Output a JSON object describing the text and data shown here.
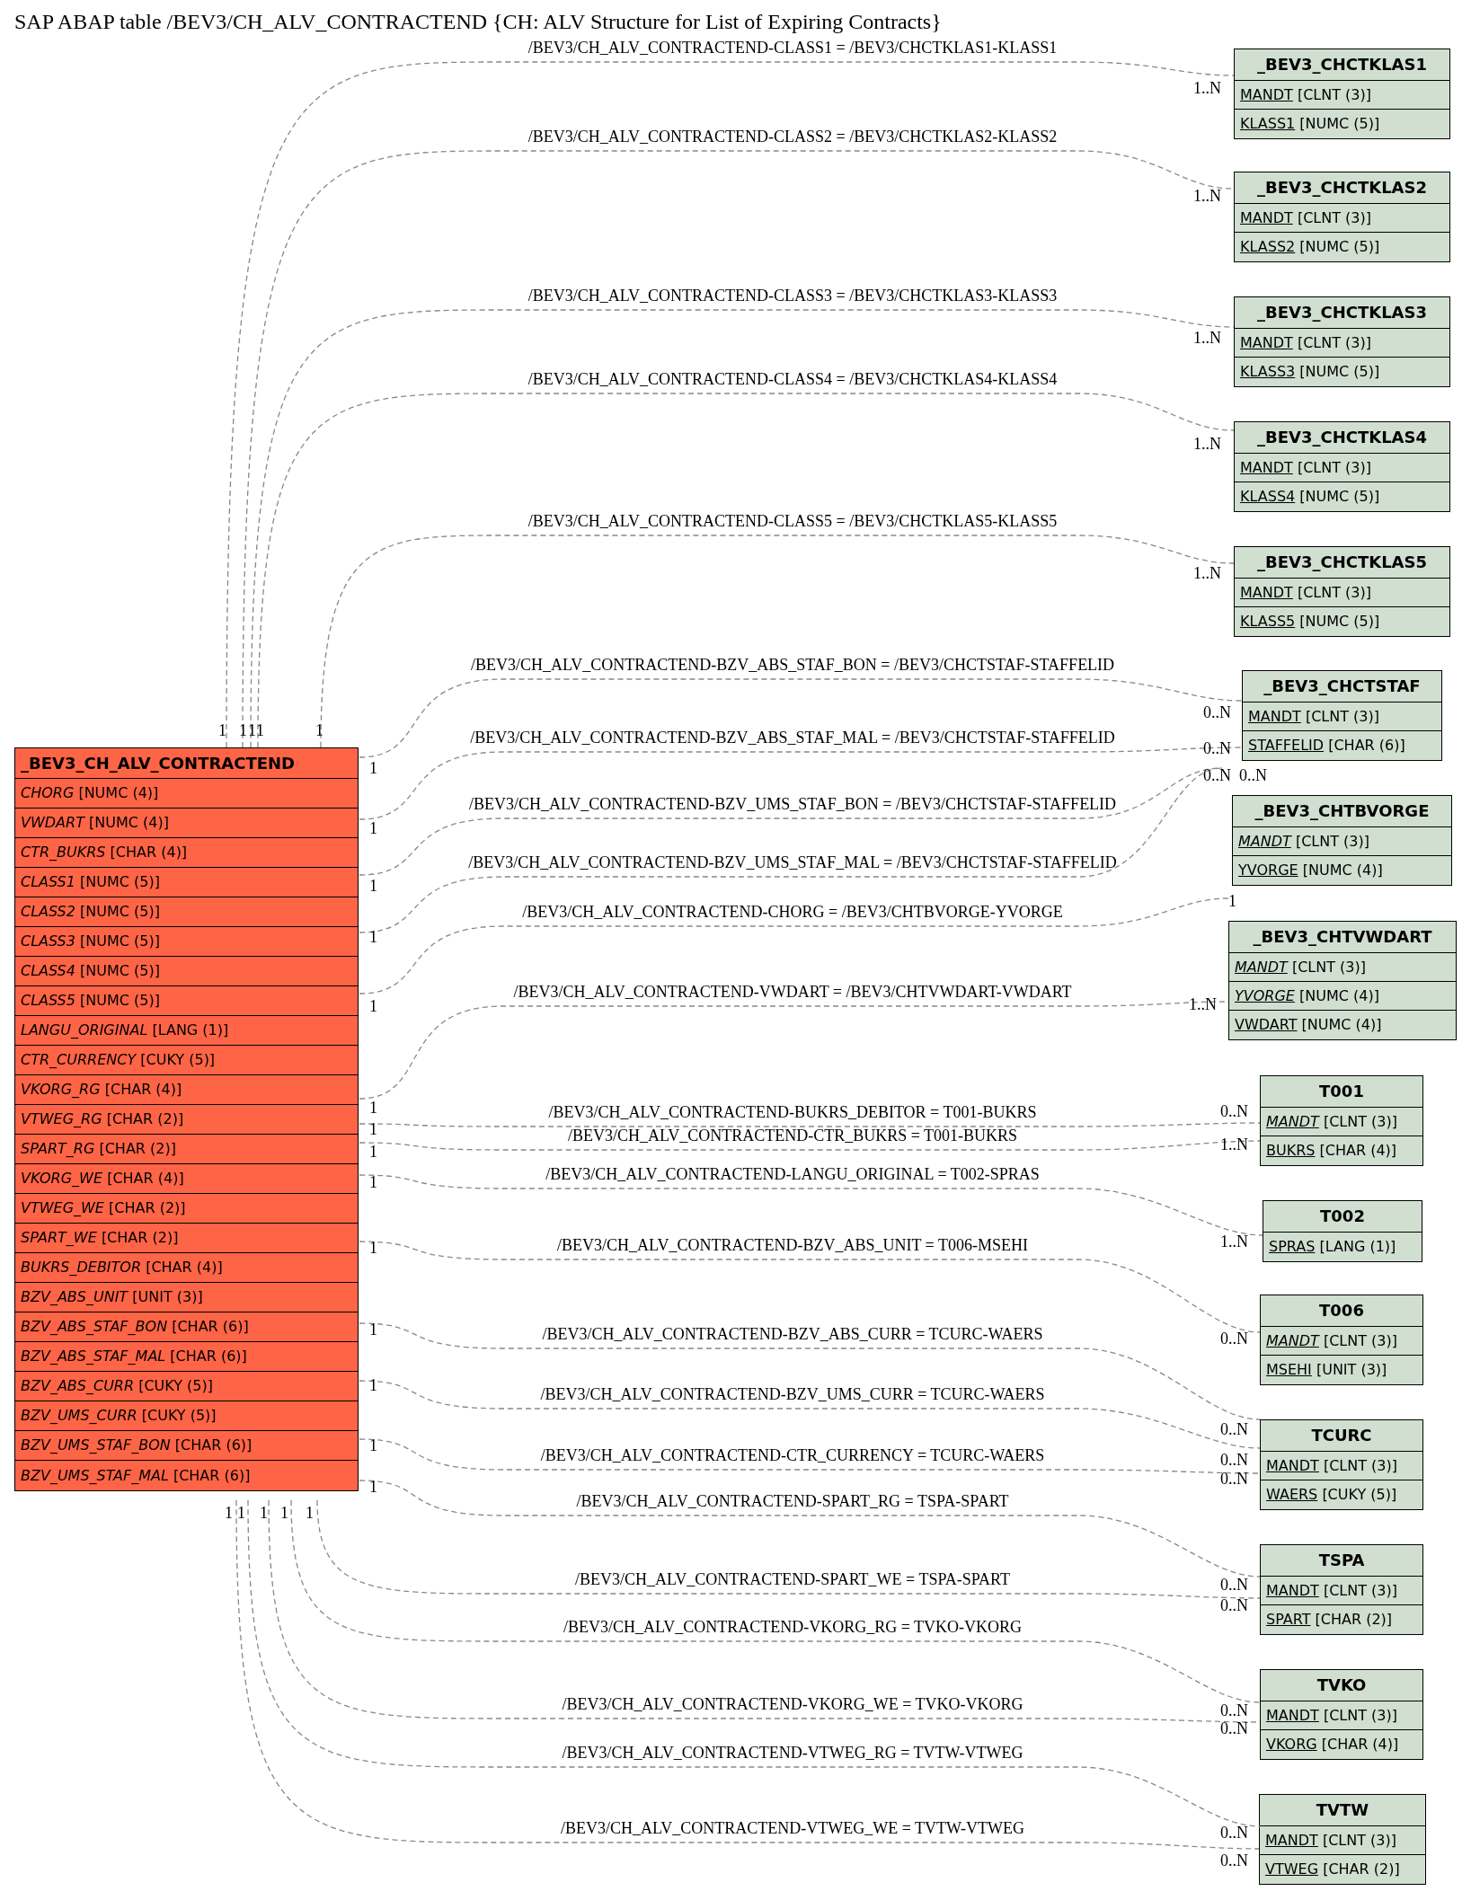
{
  "title": "SAP ABAP table /BEV3/CH_ALV_CONTRACTEND {CH: ALV Structure for List of Expiring Contracts}",
  "tables": [
    {
      "name": "_BEV3_CH_ALV_CONTRACTEND",
      "color": "#fe6446",
      "fields": [
        {
          "name": "CHORG",
          "type": "[NUMC (4)]",
          "italic": true,
          "underlined": false
        },
        {
          "name": "VWDART",
          "type": "[NUMC (4)]",
          "italic": true,
          "underlined": false
        },
        {
          "name": "CTR_BUKRS",
          "type": "[CHAR (4)]",
          "italic": true,
          "underlined": false
        },
        {
          "name": "CLASS1",
          "type": "[NUMC (5)]",
          "italic": true,
          "underlined": false
        },
        {
          "name": "CLASS2",
          "type": "[NUMC (5)]",
          "italic": true,
          "underlined": false
        },
        {
          "name": "CLASS3",
          "type": "[NUMC (5)]",
          "italic": true,
          "underlined": false
        },
        {
          "name": "CLASS4",
          "type": "[NUMC (5)]",
          "italic": true,
          "underlined": false
        },
        {
          "name": "CLASS5",
          "type": "[NUMC (5)]",
          "italic": true,
          "underlined": false
        },
        {
          "name": "LANGU_ORIGINAL",
          "type": "[LANG (1)]",
          "italic": true,
          "underlined": false
        },
        {
          "name": "CTR_CURRENCY",
          "type": "[CUKY (5)]",
          "italic": true,
          "underlined": false
        },
        {
          "name": "VKORG_RG",
          "type": "[CHAR (4)]",
          "italic": true,
          "underlined": false
        },
        {
          "name": "VTWEG_RG",
          "type": "[CHAR (2)]",
          "italic": true,
          "underlined": false
        },
        {
          "name": "SPART_RG",
          "type": "[CHAR (2)]",
          "italic": true,
          "underlined": false
        },
        {
          "name": "VKORG_WE",
          "type": "[CHAR (4)]",
          "italic": true,
          "underlined": false
        },
        {
          "name": "VTWEG_WE",
          "type": "[CHAR (2)]",
          "italic": true,
          "underlined": false
        },
        {
          "name": "SPART_WE",
          "type": "[CHAR (2)]",
          "italic": true,
          "underlined": false
        },
        {
          "name": "BUKRS_DEBITOR",
          "type": "[CHAR (4)]",
          "italic": true,
          "underlined": false
        },
        {
          "name": "BZV_ABS_UNIT",
          "type": "[UNIT (3)]",
          "italic": true,
          "underlined": false
        },
        {
          "name": "BZV_ABS_STAF_BON",
          "type": "[CHAR (6)]",
          "italic": true,
          "underlined": false
        },
        {
          "name": "BZV_ABS_STAF_MAL",
          "type": "[CHAR (6)]",
          "italic": true,
          "underlined": false
        },
        {
          "name": "BZV_ABS_CURR",
          "type": "[CUKY (5)]",
          "italic": true,
          "underlined": false
        },
        {
          "name": "BZV_UMS_CURR",
          "type": "[CUKY (5)]",
          "italic": true,
          "underlined": false
        },
        {
          "name": "BZV_UMS_STAF_BON",
          "type": "[CHAR (6)]",
          "italic": true,
          "underlined": false
        },
        {
          "name": "BZV_UMS_STAF_MAL",
          "type": "[CHAR (6)]",
          "italic": true,
          "underlined": false
        }
      ]
    },
    {
      "name": "_BEV3_CHCTKLAS1",
      "color": "#d0dfd0",
      "fields": [
        {
          "name": "MANDT",
          "type": "[CLNT (3)]",
          "italic": false,
          "underlined": true
        },
        {
          "name": "KLASS1",
          "type": "[NUMC (5)]",
          "italic": false,
          "underlined": true
        }
      ]
    },
    {
      "name": "_BEV3_CHCTKLAS2",
      "color": "#d0dfd0",
      "fields": [
        {
          "name": "MANDT",
          "type": "[CLNT (3)]",
          "italic": false,
          "underlined": true
        },
        {
          "name": "KLASS2",
          "type": "[NUMC (5)]",
          "italic": false,
          "underlined": true
        }
      ]
    },
    {
      "name": "_BEV3_CHCTKLAS3",
      "color": "#d0dfd0",
      "fields": [
        {
          "name": "MANDT",
          "type": "[CLNT (3)]",
          "italic": false,
          "underlined": true
        },
        {
          "name": "KLASS3",
          "type": "[NUMC (5)]",
          "italic": false,
          "underlined": true
        }
      ]
    },
    {
      "name": "_BEV3_CHCTKLAS4",
      "color": "#d0dfd0",
      "fields": [
        {
          "name": "MANDT",
          "type": "[CLNT (3)]",
          "italic": false,
          "underlined": true
        },
        {
          "name": "KLASS4",
          "type": "[NUMC (5)]",
          "italic": false,
          "underlined": true
        }
      ]
    },
    {
      "name": "_BEV3_CHCTKLAS5",
      "color": "#d0dfd0",
      "fields": [
        {
          "name": "MANDT",
          "type": "[CLNT (3)]",
          "italic": false,
          "underlined": true
        },
        {
          "name": "KLASS5",
          "type": "[NUMC (5)]",
          "italic": false,
          "underlined": true
        }
      ]
    },
    {
      "name": "_BEV3_CHCTSTAF",
      "color": "#d0dfd0",
      "fields": [
        {
          "name": "MANDT",
          "type": "[CLNT (3)]",
          "italic": false,
          "underlined": true
        },
        {
          "name": "STAFFELID",
          "type": "[CHAR (6)]",
          "italic": false,
          "underlined": true
        }
      ]
    },
    {
      "name": "_BEV3_CHTBVORGE",
      "color": "#d0dfd0",
      "fields": [
        {
          "name": "MANDT",
          "type": "[CLNT (3)]",
          "italic": true,
          "underlined": true
        },
        {
          "name": "YVORGE",
          "type": "[NUMC (4)]",
          "italic": false,
          "underlined": true
        }
      ]
    },
    {
      "name": "_BEV3_CHTVWDART",
      "color": "#d0dfd0",
      "fields": [
        {
          "name": "MANDT",
          "type": "[CLNT (3)]",
          "italic": true,
          "underlined": true
        },
        {
          "name": "YVORGE",
          "type": "[NUMC (4)]",
          "italic": true,
          "underlined": true
        },
        {
          "name": "VWDART",
          "type": "[NUMC (4)]",
          "italic": false,
          "underlined": true
        }
      ]
    },
    {
      "name": "T001",
      "color": "#d0dfd0",
      "fields": [
        {
          "name": "MANDT",
          "type": "[CLNT (3)]",
          "italic": true,
          "underlined": true
        },
        {
          "name": "BUKRS",
          "type": "[CHAR (4)]",
          "italic": false,
          "underlined": true
        }
      ]
    },
    {
      "name": "T002",
      "color": "#d0dfd0",
      "fields": [
        {
          "name": "SPRAS",
          "type": "[LANG (1)]",
          "italic": false,
          "underlined": true
        }
      ]
    },
    {
      "name": "T006",
      "color": "#d0dfd0",
      "fields": [
        {
          "name": "MANDT",
          "type": "[CLNT (3)]",
          "italic": true,
          "underlined": true
        },
        {
          "name": "MSEHI",
          "type": "[UNIT (3)]",
          "italic": false,
          "underlined": true
        }
      ]
    },
    {
      "name": "TCURC",
      "color": "#d0dfd0",
      "fields": [
        {
          "name": "MANDT",
          "type": "[CLNT (3)]",
          "italic": false,
          "underlined": true
        },
        {
          "name": "WAERS",
          "type": "[CUKY (5)]",
          "italic": false,
          "underlined": true
        }
      ]
    },
    {
      "name": "TSPA",
      "color": "#d0dfd0",
      "fields": [
        {
          "name": "MANDT",
          "type": "[CLNT (3)]",
          "italic": false,
          "underlined": true
        },
        {
          "name": "SPART",
          "type": "[CHAR (2)]",
          "italic": false,
          "underlined": true
        }
      ]
    },
    {
      "name": "TVKO",
      "color": "#d0dfd0",
      "fields": [
        {
          "name": "MANDT",
          "type": "[CLNT (3)]",
          "italic": false,
          "underlined": true
        },
        {
          "name": "VKORG",
          "type": "[CHAR (4)]",
          "italic": false,
          "underlined": true
        }
      ]
    },
    {
      "name": "TVTW",
      "color": "#d0dfd0",
      "fields": [
        {
          "name": "MANDT",
          "type": "[CLNT (3)]",
          "italic": false,
          "underlined": true
        },
        {
          "name": "VTWEG",
          "type": "[CHAR (2)]",
          "italic": false,
          "underlined": true
        }
      ]
    }
  ],
  "relations": [
    {
      "label": "/BEV3/CH_ALV_CONTRACTEND-CLASS1 = /BEV3/CHCTKLAS1-KLASS1",
      "from_card": "1",
      "to_card": "1..N"
    },
    {
      "label": "/BEV3/CH_ALV_CONTRACTEND-CLASS2 = /BEV3/CHCTKLAS2-KLASS2",
      "from_card": "1",
      "to_card": "1..N"
    },
    {
      "label": "/BEV3/CH_ALV_CONTRACTEND-CLASS3 = /BEV3/CHCTKLAS3-KLASS3",
      "from_card": "1",
      "to_card": "1..N"
    },
    {
      "label": "/BEV3/CH_ALV_CONTRACTEND-CLASS4 = /BEV3/CHCTKLAS4-KLASS4",
      "from_card": "1",
      "to_card": "1..N"
    },
    {
      "label": "/BEV3/CH_ALV_CONTRACTEND-CLASS5 = /BEV3/CHCTKLAS5-KLASS5",
      "from_card": "1",
      "to_card": "1..N"
    },
    {
      "label": "/BEV3/CH_ALV_CONTRACTEND-BZV_ABS_STAF_BON = /BEV3/CHCTSTAF-STAFFELID",
      "from_card": "1",
      "to_card": "0..N"
    },
    {
      "label": "/BEV3/CH_ALV_CONTRACTEND-BZV_ABS_STAF_MAL = /BEV3/CHCTSTAF-STAFFELID",
      "from_card": "1",
      "to_card": "0..N"
    },
    {
      "label": "/BEV3/CH_ALV_CONTRACTEND-BZV_UMS_STAF_BON = /BEV3/CHCTSTAF-STAFFELID",
      "from_card": "1",
      "to_card": "0..N"
    },
    {
      "label": "/BEV3/CH_ALV_CONTRACTEND-BZV_UMS_STAF_MAL = /BEV3/CHCTSTAF-STAFFELID",
      "from_card": "1",
      "to_card": "0..N"
    },
    {
      "label": "/BEV3/CH_ALV_CONTRACTEND-CHORG = /BEV3/CHTBVORGE-YVORGE",
      "from_card": "1",
      "to_card": "1"
    },
    {
      "label": "/BEV3/CH_ALV_CONTRACTEND-VWDART = /BEV3/CHTVWDART-VWDART",
      "from_card": "1",
      "to_card": "1..N"
    },
    {
      "label": "/BEV3/CH_ALV_CONTRACTEND-BUKRS_DEBITOR = T001-BUKRS",
      "from_card": "1",
      "to_card": "0..N"
    },
    {
      "label": "/BEV3/CH_ALV_CONTRACTEND-CTR_BUKRS = T001-BUKRS",
      "from_card": "1",
      "to_card": "1..N"
    },
    {
      "label": "/BEV3/CH_ALV_CONTRACTEND-LANGU_ORIGINAL = T002-SPRAS",
      "from_card": "1",
      "to_card": "1..N"
    },
    {
      "label": "/BEV3/CH_ALV_CONTRACTEND-BZV_ABS_UNIT = T006-MSEHI",
      "from_card": "1",
      "to_card": "0..N"
    },
    {
      "label": "/BEV3/CH_ALV_CONTRACTEND-BZV_ABS_CURR = TCURC-WAERS",
      "from_card": "1",
      "to_card": "0..N"
    },
    {
      "label": "/BEV3/CH_ALV_CONTRACTEND-BZV_UMS_CURR = TCURC-WAERS",
      "from_card": "1",
      "to_card": "0..N"
    },
    {
      "label": "/BEV3/CH_ALV_CONTRACTEND-CTR_CURRENCY = TCURC-WAERS",
      "from_card": "1",
      "to_card": "0..N"
    },
    {
      "label": "/BEV3/CH_ALV_CONTRACTEND-SPART_RG = TSPA-SPART",
      "from_card": "1",
      "to_card": "0..N"
    },
    {
      "label": "/BEV3/CH_ALV_CONTRACTEND-SPART_WE = TSPA-SPART",
      "from_card": "1",
      "to_card": "0..N"
    },
    {
      "label": "/BEV3/CH_ALV_CONTRACTEND-VKORG_RG = TVKO-VKORG",
      "from_card": "1",
      "to_card": "0..N"
    },
    {
      "label": "/BEV3/CH_ALV_CONTRACTEND-VKORG_WE = TVKO-VKORG",
      "from_card": "1",
      "to_card": "0..N"
    },
    {
      "label": "/BEV3/CH_ALV_CONTRACTEND-VTWEG_RG = TVTW-VTWEG",
      "from_card": "1",
      "to_card": "0..N"
    },
    {
      "label": "/BEV3/CH_ALV_CONTRACTEND-VTWEG_WE = TVTW-VTWEG",
      "from_card": "1",
      "to_card": "0..N"
    }
  ]
}
